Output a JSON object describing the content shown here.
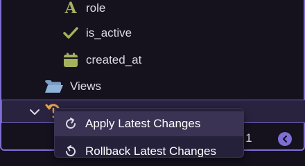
{
  "tree": {
    "items": [
      {
        "label": "role",
        "icon": "text-type-icon"
      },
      {
        "label": "is_active",
        "icon": "checkmark-icon"
      },
      {
        "label": "created_at",
        "icon": "calendar-icon"
      },
      {
        "label": "Views",
        "icon": "folder-open-icon"
      }
    ],
    "selected_icon": "migration-history-icon"
  },
  "context_menu": {
    "items": [
      {
        "label": "Apply Latest Changes",
        "icon": "redo-icon"
      },
      {
        "label": "Rollback Latest Changes",
        "icon": "undo-icon"
      }
    ]
  },
  "status": {
    "partial_text": "a 1"
  },
  "colors": {
    "accent": "#7e6fd6",
    "icon_green": "#a4b25e",
    "folder_blue": "#8fb3d9",
    "selected_icon_orange": "#e0a34c"
  }
}
